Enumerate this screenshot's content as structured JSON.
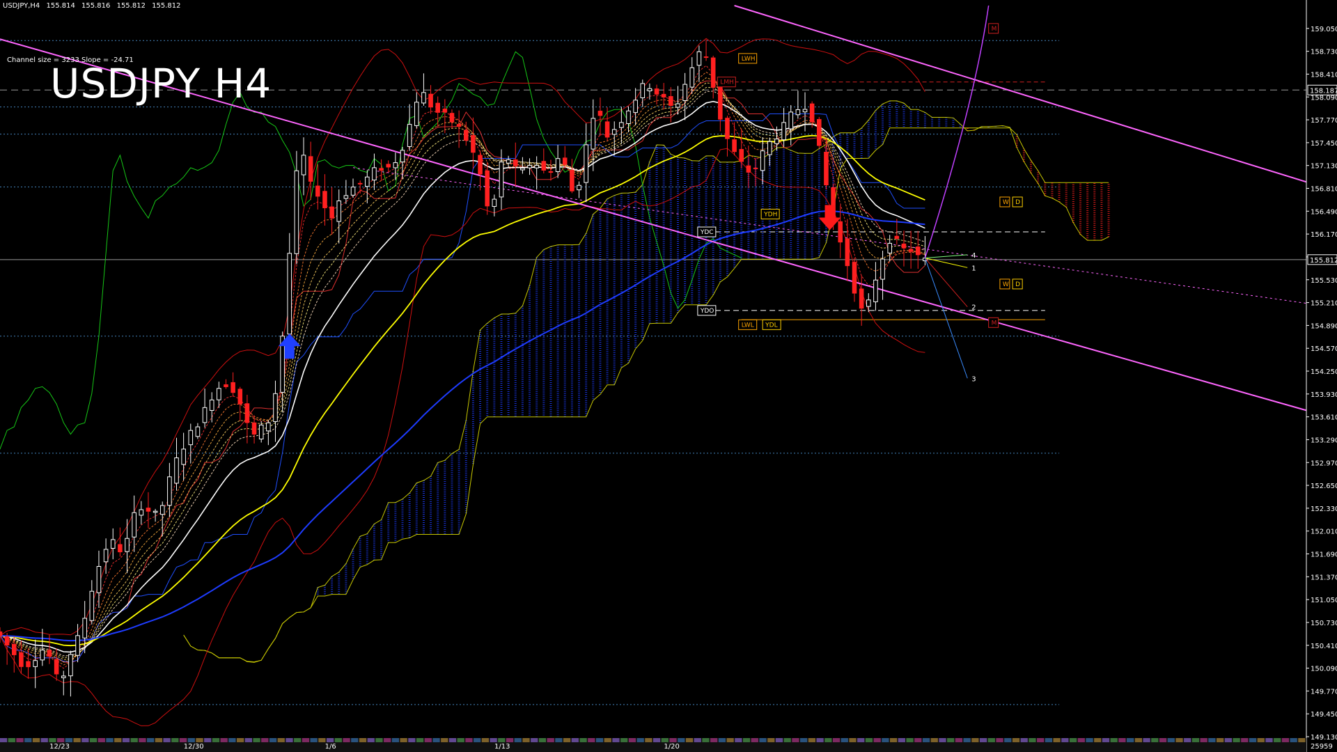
{
  "header": {
    "symbol": "USDJPY,H4",
    "ohlc": [
      "155.814",
      "155.816",
      "155.812",
      "155.812"
    ]
  },
  "channel_info": "Channel size = 3233 Slope = -24.71",
  "big_title": "USDJPY H4",
  "colors": {
    "background": "#000000",
    "bull_candle": "#ffffff",
    "bear_candle": "#ff2020",
    "channel": "#ff66ff",
    "kumo_bull": "#1e3cff",
    "kumo_bear": "#ff2020",
    "ma_yellow": "#ffff00",
    "ma_blue": "#1e3cff",
    "ma_white": "#ffffff",
    "chikou": "#16c816",
    "bollinger": "#d01010",
    "senkou": "#c8c800"
  },
  "chart_data": {
    "type": "candlestick",
    "symbol": "USDJPY",
    "timeframe": "H4",
    "ylim": [
      149.13,
      159.37
    ],
    "y_ticks": [
      "159.050",
      "158.730",
      "158.410",
      "158.090",
      "157.770",
      "157.450",
      "157.130",
      "156.810",
      "156.490",
      "156.170",
      "155.850",
      "155.530",
      "155.210",
      "154.890",
      "154.570",
      "154.250",
      "153.930",
      "153.610",
      "153.290",
      "152.970",
      "152.650",
      "152.330",
      "152.010",
      "151.690",
      "151.370",
      "151.050",
      "150.730",
      "150.410",
      "150.090",
      "149.770",
      "149.450",
      "149.130"
    ],
    "x_ticks": [
      "12/23",
      "12/30",
      "1/6",
      "1/13",
      "1/20"
    ],
    "bid_price": "155.812",
    "marked_price": "158.187",
    "volume_label": "25959",
    "level_tags": [
      "YDC",
      "YDH",
      "YDO",
      "LWL",
      "YDL",
      "LWH",
      "LMH",
      "W",
      "D",
      "M"
    ],
    "projection_labels": [
      "1",
      "2",
      "3",
      "4"
    ],
    "levels": {
      "ydc": 156.2,
      "ydh": 156.45,
      "ydo": 155.1,
      "ydl": 154.97,
      "lwh": 158.63,
      "lmh": 158.3,
      "bid": 155.812,
      "marked": 158.187,
      "top_dotted": 158.88
    },
    "price_path": [
      [
        0,
        150.6
      ],
      [
        4,
        150.1
      ],
      [
        7,
        150.4
      ],
      [
        9,
        149.8
      ],
      [
        10,
        150.2
      ],
      [
        12,
        150.6
      ],
      [
        14,
        151.4
      ],
      [
        16,
        151.9
      ],
      [
        18,
        151.7
      ],
      [
        20,
        152.4
      ],
      [
        23,
        152.2
      ],
      [
        25,
        152.9
      ],
      [
        27,
        153.3
      ],
      [
        29,
        153.6
      ],
      [
        31,
        154.0
      ],
      [
        33,
        154.1
      ],
      [
        35,
        153.7
      ],
      [
        36,
        153.3
      ],
      [
        38,
        153.5
      ],
      [
        39,
        153.6
      ],
      [
        40,
        154.3
      ],
      [
        41,
        155.2
      ],
      [
        42,
        156.6
      ],
      [
        43,
        157.4
      ],
      [
        44,
        157.1
      ],
      [
        45,
        156.6
      ],
      [
        46,
        156.9
      ],
      [
        47,
        156.2
      ],
      [
        48,
        156.6
      ],
      [
        50,
        156.8
      ],
      [
        52,
        156.9
      ],
      [
        54,
        157.1
      ],
      [
        56,
        157.1
      ],
      [
        58,
        157.5
      ],
      [
        59,
        157.9
      ],
      [
        60,
        158.2
      ],
      [
        62,
        157.9
      ],
      [
        64,
        157.8
      ],
      [
        66,
        157.6
      ],
      [
        68,
        157.2
      ],
      [
        69,
        156.8
      ],
      [
        70,
        156.3
      ],
      [
        71,
        157.0
      ],
      [
        72,
        157.3
      ],
      [
        74,
        157.0
      ],
      [
        76,
        157.2
      ],
      [
        78,
        157.0
      ],
      [
        80,
        157.3
      ],
      [
        82,
        156.6
      ],
      [
        83,
        157.2
      ],
      [
        84,
        157.6
      ],
      [
        85,
        158.1
      ],
      [
        86,
        157.5
      ],
      [
        88,
        157.7
      ],
      [
        90,
        158.0
      ],
      [
        92,
        158.3
      ],
      [
        94,
        158.1
      ],
      [
        96,
        157.9
      ],
      [
        98,
        158.4
      ],
      [
        100,
        158.8
      ],
      [
        101,
        158.5
      ],
      [
        102,
        158.0
      ],
      [
        103,
        157.6
      ],
      [
        105,
        157.2
      ],
      [
        107,
        157.0
      ],
      [
        109,
        157.4
      ],
      [
        111,
        157.6
      ],
      [
        113,
        157.9
      ],
      [
        115,
        158.0
      ],
      [
        116,
        157.6
      ],
      [
        117,
        157.1
      ],
      [
        118,
        156.6
      ],
      [
        119,
        156.2
      ],
      [
        120,
        155.9
      ],
      [
        121,
        155.6
      ],
      [
        122,
        155.2
      ],
      [
        123,
        155.0
      ],
      [
        124,
        155.4
      ],
      [
        125,
        155.7
      ],
      [
        126,
        156.0
      ],
      [
        127,
        156.2
      ],
      [
        128,
        155.9
      ],
      [
        129,
        156.0
      ],
      [
        130,
        155.9
      ],
      [
        131,
        155.8
      ]
    ],
    "channel": [
      {
        "role": "upper",
        "x": [
          104,
          185
        ],
        "y": [
          159.37,
          156.9
        ]
      },
      {
        "role": "middle",
        "x": [
          50,
          185
        ],
        "y": [
          157.1,
          155.2
        ]
      },
      {
        "role": "lower",
        "x": [
          0,
          185
        ],
        "y": [
          158.9,
          153.7
        ]
      }
    ]
  }
}
